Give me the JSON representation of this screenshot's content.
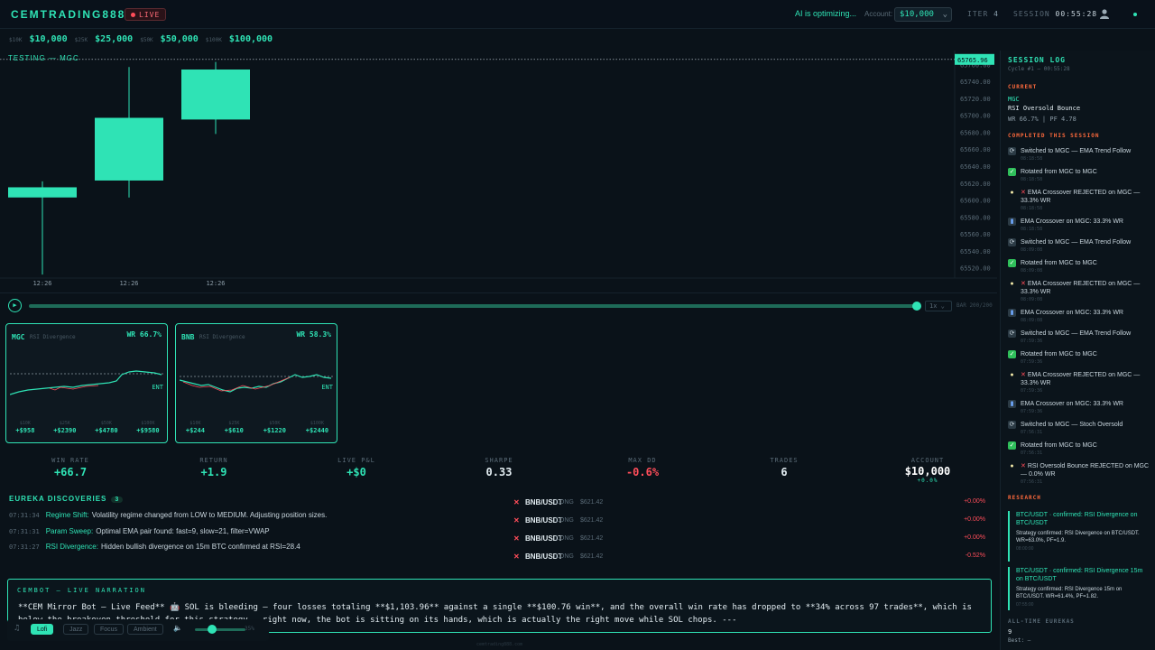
{
  "topbar": {
    "brand": "CEMTRADING888",
    "live": "LIVE",
    "status": "AI is optimizing...",
    "account_label": "Account:",
    "account_value": "$10,000",
    "iter_label": "ITER",
    "iter_value": "4",
    "session_label": "SESSION",
    "session_value": "00:55:28"
  },
  "tiers": [
    {
      "label": "$10K",
      "value": "$10,000"
    },
    {
      "label": "$25K",
      "value": "$25,000"
    },
    {
      "label": "$50K",
      "value": "$50,000"
    },
    {
      "label": "$100K",
      "value": "$100,000"
    }
  ],
  "main_chart": {
    "label": "TESTING — MGC",
    "price_tag": "65765.96",
    "y_ticks": [
      "65760.00",
      "65740.00",
      "65720.00",
      "65700.00",
      "65680.00",
      "65660.00",
      "65640.00",
      "65620.00",
      "65600.00",
      "65580.00",
      "65560.00",
      "65540.00",
      "65520.00"
    ],
    "x_ticks": [
      "12:26",
      "12:26",
      "12:26"
    ]
  },
  "chart_data": {
    "type": "candlestick",
    "x": [
      "12:26",
      "12:26",
      "12:26"
    ],
    "open": [
      65615,
      65623,
      65695
    ],
    "close": [
      65603,
      65697,
      65754
    ],
    "high": [
      65622,
      65757,
      65763
    ],
    "low": [
      65512,
      65603,
      65678
    ],
    "ylim": [
      65510,
      65770
    ],
    "current": 65765.96
  },
  "scrub": {
    "play": "▶",
    "speed": "1x",
    "bar_count": "BAR 200/200"
  },
  "mini_cards": [
    {
      "symbol": "MGC",
      "strategy": "RSI Divergence",
      "wr": "WR 66.7%",
      "ent": "ENT",
      "pnl": [
        {
          "a": "$10K",
          "b": "+$958"
        },
        {
          "a": "$25K",
          "b": "+$2390"
        },
        {
          "a": "$50K",
          "b": "+$4780"
        },
        {
          "a": "$100K",
          "b": "+$9580"
        }
      ]
    },
    {
      "symbol": "BNB",
      "strategy": "RSI Divergence",
      "wr": "WR 58.3%",
      "ent": "ENT",
      "pnl": [
        {
          "a": "$10K",
          "b": "+$244"
        },
        {
          "a": "$25K",
          "b": "+$610"
        },
        {
          "a": "$50K",
          "b": "+$1220"
        },
        {
          "a": "$100K",
          "b": "+$2440"
        }
      ]
    }
  ],
  "stats": [
    {
      "k": "WIN RATE",
      "v": "+66.7"
    },
    {
      "k": "RETURN",
      "v": "+1.9"
    },
    {
      "k": "LIVE P&L",
      "v": "+$0"
    },
    {
      "k": "SHARPE",
      "v": "0.33"
    },
    {
      "k": "MAX DD",
      "v": "-0.6%"
    },
    {
      "k": "TRADES",
      "v": "6"
    }
  ],
  "account": {
    "label": "ACCOUNT",
    "value": "$10,000",
    "delta": "+0.0%"
  },
  "eureka": {
    "title": "EUREKA DISCOVERIES",
    "count": "3",
    "items": [
      {
        "t": "07:31:34",
        "n": "Regime Shift:",
        "m": "Volatility regime changed from LOW to MEDIUM. Adjusting position sizes."
      },
      {
        "t": "07:31:31",
        "n": "Param Sweep:",
        "m": "Optimal EMA pair found: fast=9, slow=21, filter=VWAP"
      },
      {
        "t": "07:31:27",
        "n": "RSI Divergence:",
        "m": "Hidden bullish divergence on 15m BTC confirmed at RSI=28.4"
      }
    ]
  },
  "trades": [
    {
      "sym": "BNB/USDT",
      "dir": "LONG",
      "price": "$621.42",
      "ret": "+0.00%"
    },
    {
      "sym": "BNB/USDT",
      "dir": "LONG",
      "price": "$621.42",
      "ret": "+0.00%"
    },
    {
      "sym": "BNB/USDT",
      "dir": "LONG",
      "price": "$621.42",
      "ret": "+0.00%"
    },
    {
      "sym": "BNB/USDT",
      "dir": "LONG",
      "price": "$621.42",
      "ret": "-0.52%"
    }
  ],
  "narration": {
    "title": "CEMBOT — LIVE NARRATION",
    "text": "**CEM Mirror Bot — Live Feed** 🤖 SOL is bleeding — four losses totaling **$1,103.96** against a single **$100.76 win**, and the overall win rate has dropped to **34% across 97 trades**, which is below the breakeven threshold for this strategy — right now, the bot is sitting on its hands, which is actually the right move while SOL chops. ---"
  },
  "music": {
    "buttons": [
      "Lofi",
      "Jazz",
      "Focus",
      "Ambient"
    ],
    "volume": "35%"
  },
  "footer": "cemtrading888.com",
  "side": {
    "title": "SESSION LOG",
    "cycle": "Cycle #1 — 00:55:28",
    "current_label": "CURRENT",
    "current_sym": "MGC",
    "current_strat": "RSI Oversold Bounce",
    "current_stats": "WR 66.7% | PF 4.78",
    "completed_label": "COMPLETED THIS SESSION",
    "events": [
      {
        "type": "switch",
        "text": "Switched to MGC — EMA Trend Follow",
        "time": "08:18:58"
      },
      {
        "type": "ok",
        "text": "Rotated from MGC to MGC",
        "time": "08:18:58"
      },
      {
        "type": "bulb",
        "text": "EMA Crossover REJECTED on MGC — 33.3% WR",
        "time": "08:18:58"
      },
      {
        "type": "chart",
        "text": "EMA Crossover on MGC: 33.3% WR",
        "time": "08:18:58"
      },
      {
        "type": "switch",
        "text": "Switched to MGC — EMA Trend Follow",
        "time": "08:09:08"
      },
      {
        "type": "ok",
        "text": "Rotated from MGC to MGC",
        "time": "08:09:08"
      },
      {
        "type": "bulb",
        "text": "EMA Crossover REJECTED on MGC — 33.3% WR",
        "time": "08:09:08"
      },
      {
        "type": "chart",
        "text": "EMA Crossover on MGC: 33.3% WR",
        "time": "08:09:08"
      },
      {
        "type": "switch",
        "text": "Switched to MGC — EMA Trend Follow",
        "time": "07:59:36"
      },
      {
        "type": "ok",
        "text": "Rotated from MGC to MGC",
        "time": "07:59:36"
      },
      {
        "type": "bulb",
        "text": "EMA Crossover REJECTED on MGC — 33.3% WR",
        "time": "07:59:36"
      },
      {
        "type": "chart",
        "text": "EMA Crossover on MGC: 33.3% WR",
        "time": "07:59:36"
      },
      {
        "type": "switch",
        "text": "Switched to MGC — Stoch Oversold",
        "time": "07:56:31"
      },
      {
        "type": "ok",
        "text": "Rotated from MGC to MGC",
        "time": "07:56:31"
      },
      {
        "type": "bulb",
        "text": "RSI Oversold Bounce REJECTED on MGC — 0.0% WR",
        "time": "07:56:31"
      }
    ],
    "research_label": "RESEARCH",
    "research": [
      {
        "title": "BTC/USDT · confirmed: RSI Divergence on BTC/USDT",
        "body": "Strategy confirmed: RSI Divergence on BTC/USDT. WR=63.0%, PF=1.9.",
        "time": "08:00:00"
      },
      {
        "title": "BTC/USDT · confirmed: RSI Divergence 15m on BTC/USDT",
        "body": "Strategy confirmed: RSI Divergence 15m on BTC/USDT. WR=61.4%, PF=1.82.",
        "time": "07:55:00"
      }
    ],
    "alltime_label": "ALL-TIME EUREKAS",
    "alltime_count": "9",
    "best": "Best: —"
  },
  "colors": {
    "accent": "#2fe3b5",
    "loss": "#ff4d5a",
    "bg": "#0a1219"
  }
}
